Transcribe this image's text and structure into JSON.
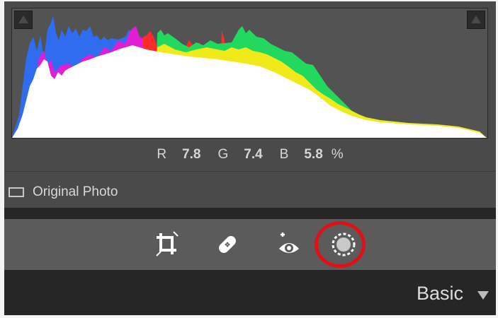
{
  "histogram": {
    "readout": {
      "r_label": "R",
      "r_value": "7.8",
      "g_label": "G",
      "g_value": "7.4",
      "b_label": "B",
      "b_value": "5.8",
      "unit": "%"
    }
  },
  "original_photo": {
    "label": "Original Photo",
    "checked": false
  },
  "tools": [
    {
      "name": "crop",
      "icon": "crop-icon"
    },
    {
      "name": "spot-removal",
      "icon": "bandage-icon"
    },
    {
      "name": "red-eye",
      "icon": "red-eye-icon"
    },
    {
      "name": "masking",
      "icon": "mask-icon",
      "highlighted": true
    }
  ],
  "panel": {
    "title": "Basic"
  },
  "colors": {
    "highlight": "#dd1219",
    "panel_bg": "#4a4a4a",
    "header_bg": "#262626"
  }
}
